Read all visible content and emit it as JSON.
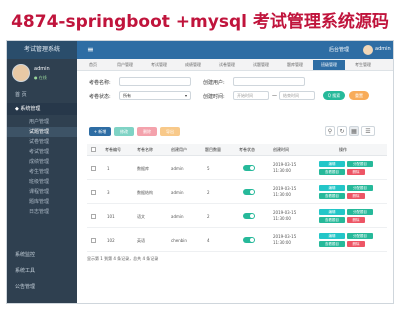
{
  "banner": {
    "title": "4874-springboot +mysql 考试管理系统源码"
  },
  "header": {
    "brand": "考试管理系统",
    "menu_icon": "≡",
    "system_label": "后台管理",
    "username": "admin"
  },
  "sidebar": {
    "user": {
      "name": "admin",
      "status": "● 在线"
    },
    "items": [
      {
        "label": "首 页"
      },
      {
        "label": "◆ 系统管理"
      }
    ],
    "sub_items": [
      {
        "label": "用户管理"
      },
      {
        "label": "试题管理"
      },
      {
        "label": "试卷管理"
      },
      {
        "label": "考试管理"
      },
      {
        "label": "成绩管理"
      },
      {
        "label": "考生管理"
      },
      {
        "label": "班级管理"
      },
      {
        "label": "课程管理"
      },
      {
        "label": "题库管理"
      },
      {
        "label": "日志管理"
      }
    ],
    "bottom_items": [
      {
        "label": "系统监控"
      },
      {
        "label": "系统工具"
      },
      {
        "label": "公告管理"
      }
    ]
  },
  "tabs": [
    {
      "label": "首页"
    },
    {
      "label": "用户管理"
    },
    {
      "label": "考试管理"
    },
    {
      "label": "成绩管理"
    },
    {
      "label": "试卷管理"
    },
    {
      "label": "试题管理"
    },
    {
      "label": "题库管理"
    },
    {
      "label": "班级管理"
    },
    {
      "label": "考生管理"
    }
  ],
  "search": {
    "name_label": "考卷名称:",
    "name_placeholder": "",
    "creator_label": "创建用户:",
    "creator_placeholder": "",
    "status_label": "考卷状态:",
    "status_value": "所有",
    "time_label": "创建时间:",
    "time_start": "开始时间",
    "time_sep": "—",
    "time_end": "结束时间",
    "search_btn": "Q 搜索",
    "reset_btn": "重置"
  },
  "toolbar": {
    "add": "+ 新增",
    "edit": "修改",
    "delete": "删除",
    "export": "导出"
  },
  "table": {
    "headers": [
      "",
      "考卷编号",
      "考卷名称",
      "创建用户",
      "题目数量",
      "考卷状态",
      "创建时间",
      "操作"
    ],
    "rows": [
      {
        "id": "1",
        "name": "数据库",
        "creator": "admin",
        "count": "5",
        "time": "2019-03-15 11:30:00"
      },
      {
        "id": "3",
        "name": "数据结构",
        "creator": "admin",
        "count": "2",
        "time": "2019-03-15 11:30:00"
      },
      {
        "id": "101",
        "name": "语文",
        "creator": "admin",
        "count": "2",
        "time": "2019-03-15 11:30:00"
      },
      {
        "id": "102",
        "name": "英语",
        "creator": "chenbin",
        "count": "4",
        "time": "2019-03-15 11:30:00"
      }
    ],
    "actions": {
      "edit": "编辑",
      "assign": "分配题目",
      "view": "查看题目",
      "delete": "删除"
    }
  },
  "footer": {
    "summary": "显示第 1 到第 4 条记录，总共 4 条记录"
  },
  "colors": {
    "primary": "#2e6da4",
    "sidebar": "#2f4050",
    "success": "#26b99a",
    "warning": "#f8ac59",
    "danger": "#ed5565",
    "info": "#23c6c8",
    "banner": "#c0143c"
  }
}
